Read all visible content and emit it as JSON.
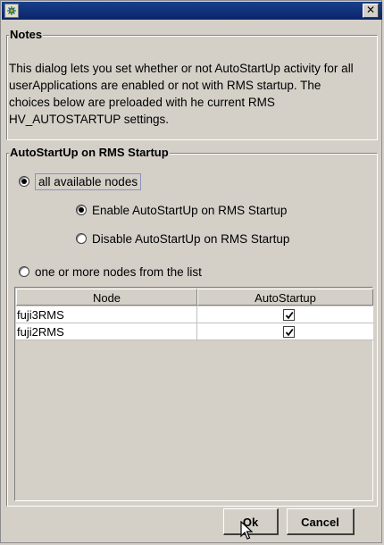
{
  "window": {
    "title": "",
    "close_glyph": "✕"
  },
  "notes": {
    "legend": "Notes",
    "text": "This dialog lets you set whether or not AutoStartUp activity for all userApplications are enabled or not with RMS startup. The choices below are preloaded with he current RMS HV_AUTOSTARTUP settings."
  },
  "autostart": {
    "legend": "AutoStartUp on RMS Startup",
    "all_nodes_label": "all available nodes",
    "all_nodes_selected": true,
    "enable_label": "Enable AutoStartUp on RMS Startup",
    "enable_selected": true,
    "disable_label": "Disable AutoStartUp on RMS Startup",
    "disable_selected": false,
    "list_label": "one or more nodes from the list",
    "list_selected": false
  },
  "table": {
    "columns": [
      "Node",
      "AutoStartup"
    ],
    "rows": [
      {
        "node": "fuji3RMS",
        "autostartup": true
      },
      {
        "node": "fuji2RMS",
        "autostartup": true
      }
    ]
  },
  "buttons": {
    "ok": "Ok",
    "cancel": "Cancel"
  },
  "icons": {
    "app": "app-icon",
    "close": "close-icon",
    "check": "checkmark-icon",
    "cursor": "mouse-pointer-icon"
  }
}
